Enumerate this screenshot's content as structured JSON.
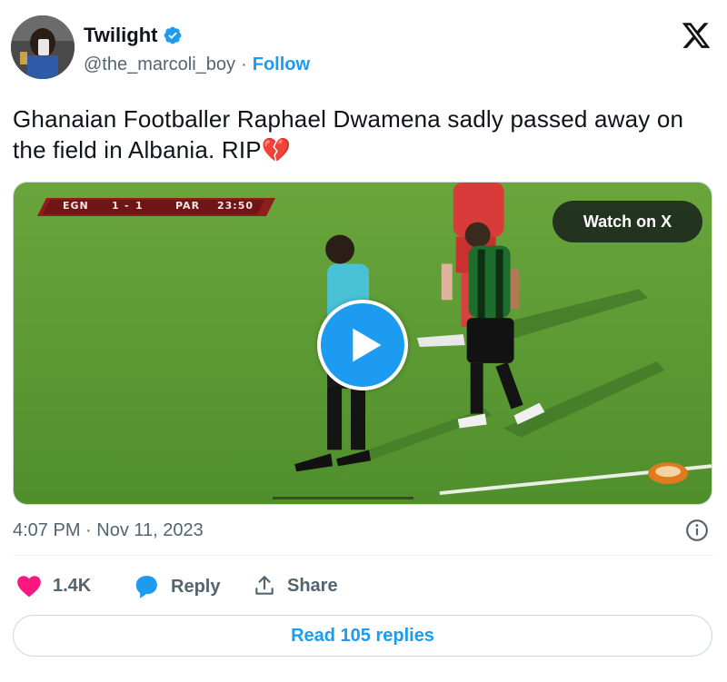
{
  "user": {
    "display_name": "Twilight",
    "handle": "@the_marcoli_boy",
    "separator": "·",
    "follow_label": "Follow",
    "verified": true
  },
  "brand": {
    "logo": "x-logo-icon"
  },
  "tweet": {
    "text": "Ghanaian Footballer Raphael Dwamena sadly passed away on the field in Albania. RIP💔"
  },
  "media": {
    "watch_label": "Watch on X",
    "scoreboard": {
      "team_home": "EGN",
      "score_home": "1",
      "score_sep": "-",
      "score_away": "1",
      "team_away": "PAR",
      "clock": "23:50"
    },
    "progress_fraction": 0.26
  },
  "meta": {
    "timestamp": "4:07 PM · Nov 11, 2023"
  },
  "actions": {
    "like_count": "1.4K",
    "reply_label": "Reply",
    "share_label": "Share",
    "read_replies_label": "Read 105 replies"
  },
  "colors": {
    "accent": "#1d9bf0",
    "like": "#f91880",
    "muted_text": "#536471",
    "pitch": "#5b9a33"
  }
}
